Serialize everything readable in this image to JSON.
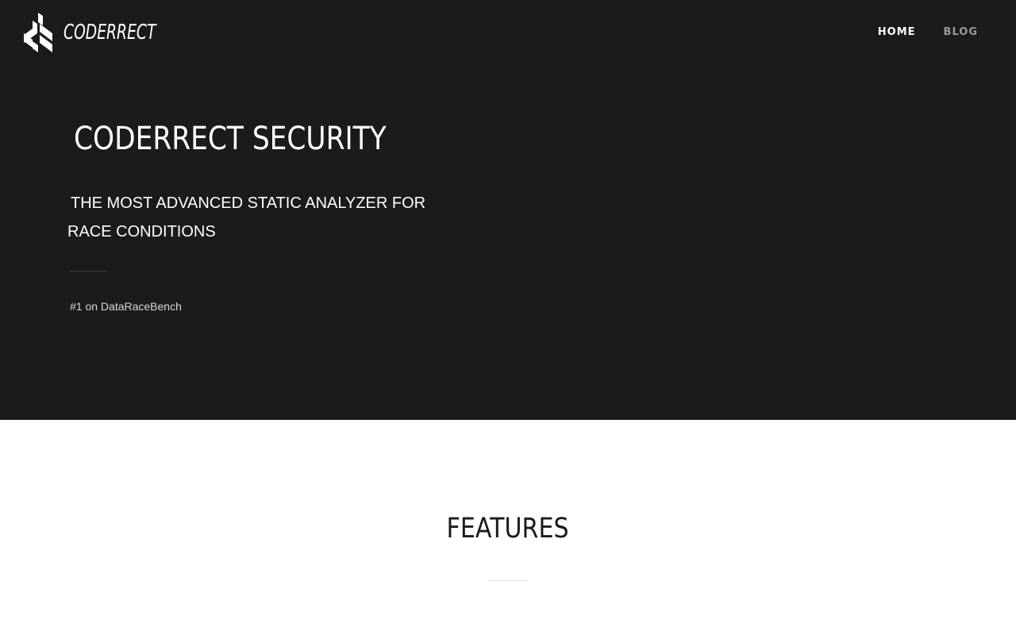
{
  "header": {
    "logo_text": "CODERRECT",
    "logo_icon": "coderrect-logo-icon",
    "nav": [
      {
        "label": "HOME",
        "active": true
      },
      {
        "label": "BLOG",
        "active": false
      }
    ]
  },
  "hero": {
    "title": "CODERRECT SECURITY",
    "subtitle": "THE MOST ADVANCED STATIC ANALYZER FOR RACE CONDITIONS",
    "tagline": "#1 on DataRaceBench"
  },
  "features": {
    "title": "FEATURES"
  },
  "colors": {
    "hero_bg": "#1b1b1b",
    "nav_active": "#ffffff",
    "nav_inactive": "#9a9a9a",
    "page_bg": "#ffffff"
  }
}
